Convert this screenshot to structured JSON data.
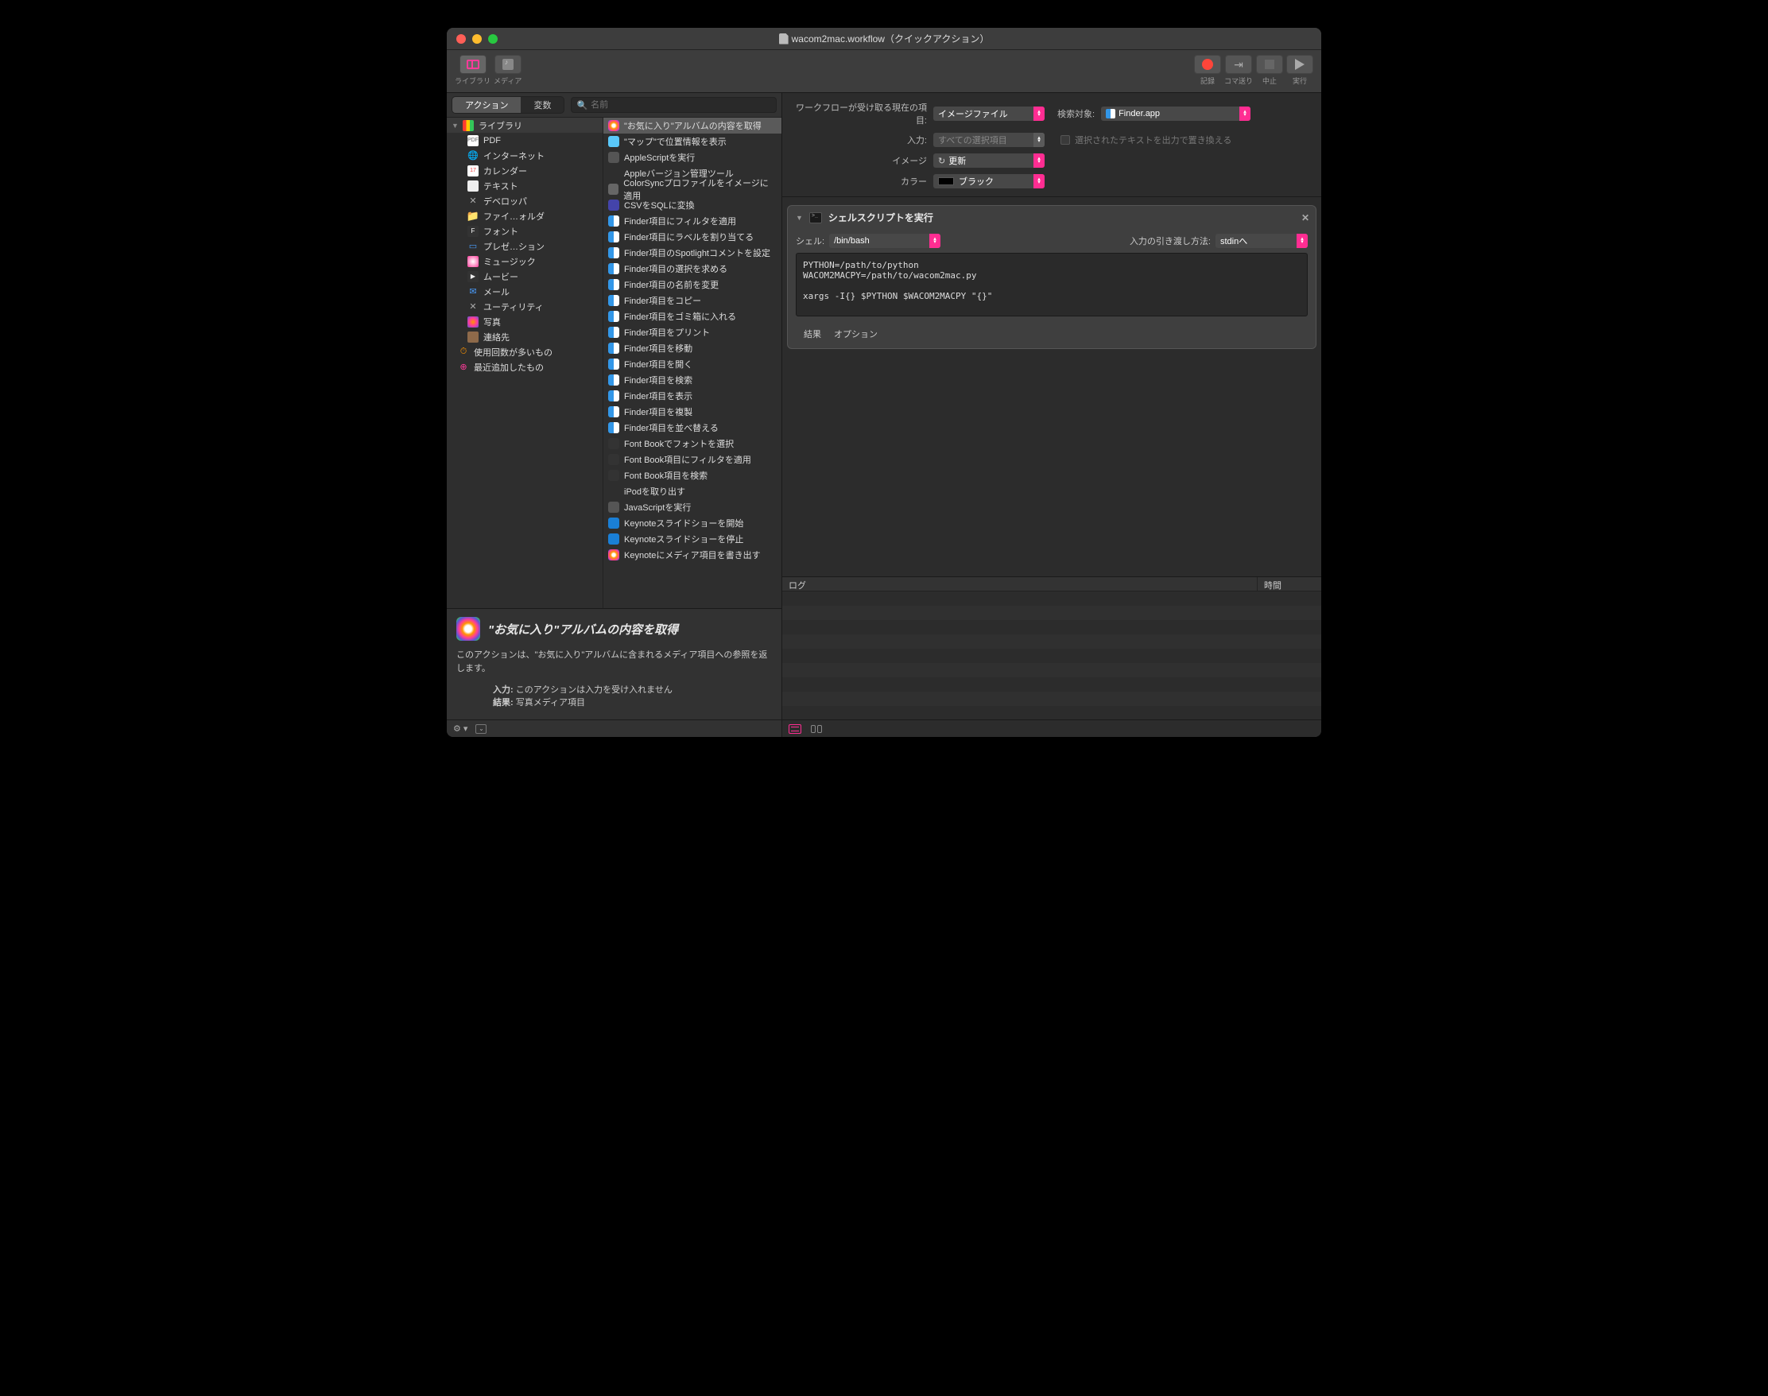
{
  "window": {
    "title": "wacom2mac.workflow（クイックアクション）"
  },
  "toolbar": {
    "library": "ライブラリ",
    "media": "メディア",
    "record": "記録",
    "step": "コマ送り",
    "stop": "中止",
    "run": "実行"
  },
  "left_tabs": {
    "action": "アクション",
    "variable": "変数",
    "search_placeholder": "名前"
  },
  "library_tree": {
    "header": "ライブラリ",
    "items": [
      "PDF",
      "インターネット",
      "カレンダー",
      "テキスト",
      "デベロッパ",
      "ファイ…ォルダ",
      "フォント",
      "プレゼ…ション",
      "ミュージック",
      "ムービー",
      "メール",
      "ユーティリティ",
      "写真",
      "連絡先"
    ],
    "most_used": "使用回数が多いもの",
    "recently_added": "最近追加したもの"
  },
  "actions": {
    "items": [
      "\"お気に入り\"アルバムの内容を取得",
      "\"マップ\"で位置情報を表示",
      "AppleScriptを実行",
      "Appleバージョン管理ツール",
      "ColorSyncプロファイルをイメージに適用",
      "CSVをSQLに変換",
      "Finder項目にフィルタを適用",
      "Finder項目にラベルを割り当てる",
      "Finder項目のSpotlightコメントを設定",
      "Finder項目の選択を求める",
      "Finder項目の名前を変更",
      "Finder項目をコピー",
      "Finder項目をゴミ箱に入れる",
      "Finder項目をプリント",
      "Finder項目を移動",
      "Finder項目を開く",
      "Finder項目を検索",
      "Finder項目を表示",
      "Finder項目を複製",
      "Finder項目を並べ替える",
      "Font Bookでフォントを選択",
      "Font Book項目にフィルタを適用",
      "Font Book項目を検索",
      "iPodを取り出す",
      "JavaScriptを実行",
      "Keynoteスライドショーを開始",
      "Keynoteスライドショーを停止",
      "Keynoteにメディア項目を書き出す"
    ]
  },
  "description": {
    "title": "\"お気に入り\"アルバムの内容を取得",
    "body": "このアクションは、\"お気に入り\"アルバムに含まれるメディア項目への参照を返します。",
    "input_label": "入力:",
    "input_value": "このアクションは入力を受け入れません",
    "result_label": "結果:",
    "result_value": "写真メディア項目"
  },
  "workflow_header": {
    "receives_label": "ワークフローが受け取る現在の項目:",
    "receives_value": "イメージファイル",
    "search_target_label": "検索対象:",
    "search_target_value": "Finder.app",
    "input_label": "入力:",
    "input_value": "すべての選択項目",
    "replace_checkbox": "選択されたテキストを出力で置き換える",
    "image_label": "イメージ",
    "image_value": "更新",
    "color_label": "カラー",
    "color_value": "ブラック"
  },
  "shell_action": {
    "title": "シェルスクリプトを実行",
    "shell_label": "シェル:",
    "shell_value": "/bin/bash",
    "pass_label": "入力の引き渡し方法:",
    "pass_value": "stdinへ",
    "script": "PYTHON=/path/to/python\nWACOM2MACPY=/path/to/wacom2mac.py\n\nxargs -I{} $PYTHON $WACOM2MACPY \"{}\"",
    "results": "結果",
    "options": "オプション"
  },
  "log": {
    "col_log": "ログ",
    "col_time": "時間"
  }
}
